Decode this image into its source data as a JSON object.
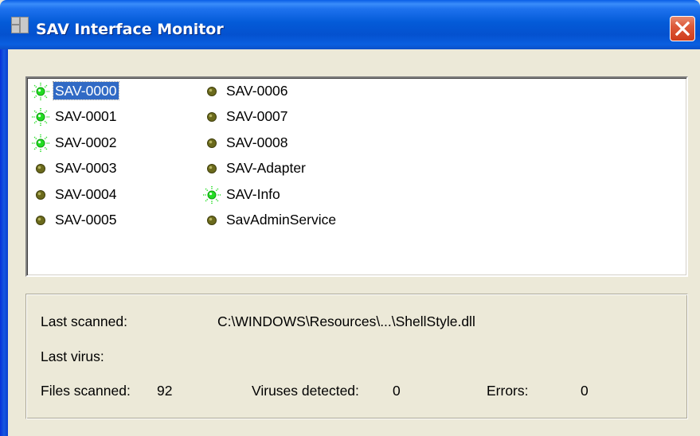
{
  "window": {
    "title": "SAV Interface Monitor",
    "close_label": "×"
  },
  "interfaces": {
    "column_1": [
      {
        "name": "SAV-0000",
        "status": "active",
        "selected": true
      },
      {
        "name": "SAV-0001",
        "status": "active",
        "selected": false
      },
      {
        "name": "SAV-0002",
        "status": "active",
        "selected": false
      },
      {
        "name": "SAV-0003",
        "status": "inactive",
        "selected": false
      },
      {
        "name": "SAV-0004",
        "status": "inactive",
        "selected": false
      },
      {
        "name": "SAV-0005",
        "status": "inactive",
        "selected": false
      }
    ],
    "column_2": [
      {
        "name": "SAV-0006",
        "status": "inactive",
        "selected": false
      },
      {
        "name": "SAV-0007",
        "status": "inactive",
        "selected": false
      },
      {
        "name": "SAV-0008",
        "status": "inactive",
        "selected": false
      },
      {
        "name": "SAV-Adapter",
        "status": "inactive",
        "selected": false
      },
      {
        "name": "SAV-Info",
        "status": "active",
        "selected": false
      },
      {
        "name": "SavAdminService",
        "status": "inactive",
        "selected": false
      }
    ],
    "icons": {
      "active": "green-status-light-icon",
      "inactive": "olive-status-dot-icon"
    },
    "colors": {
      "active": "#22dd22",
      "inactive": "#6b6a1c",
      "selection": "#316ac5"
    }
  },
  "status": {
    "last_scanned_label": "Last scanned:",
    "last_scanned_value": "C:\\WINDOWS\\Resources\\...\\ShellStyle.dll",
    "last_virus_label": "Last virus:",
    "last_virus_value": "",
    "files_scanned_label": "Files scanned:",
    "files_scanned_value": "92",
    "viruses_detected_label": "Viruses detected:",
    "viruses_detected_value": "0",
    "errors_label": "Errors:",
    "errors_value": "0"
  }
}
